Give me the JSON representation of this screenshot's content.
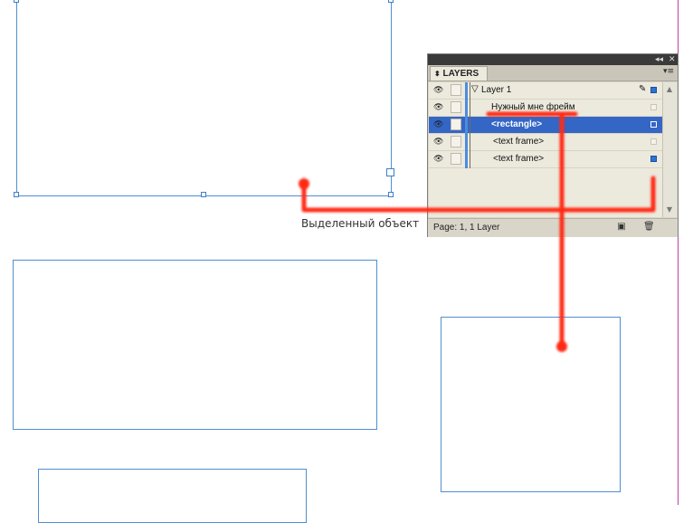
{
  "panel": {
    "tab_label": "LAYERS",
    "tab_arrows": "⬍",
    "collapse_label": "◂◂",
    "close_label": "✕",
    "menu_label": "▾≡",
    "layers": [
      {
        "label": "Layer 1",
        "type": "layer",
        "color": "#2f73d0"
      },
      {
        "label": "Нужный мне фрейм",
        "type": "item"
      },
      {
        "label": "<rectangle>",
        "type": "item",
        "selected": true
      },
      {
        "label": "<text frame>",
        "type": "item"
      },
      {
        "label": "<text frame>",
        "type": "item",
        "marked": true
      }
    ],
    "status": "Page: 1, 1 Layer",
    "new_layer_icon": "new-layer-icon",
    "trash_icon": "trash-icon"
  },
  "annotation": {
    "caption": "Выделенный объект",
    "color": "#ff2a12"
  },
  "colors": {
    "frame_border": "#4f8fd1",
    "guide": "#c53ca5",
    "selection": "#3466c5"
  }
}
